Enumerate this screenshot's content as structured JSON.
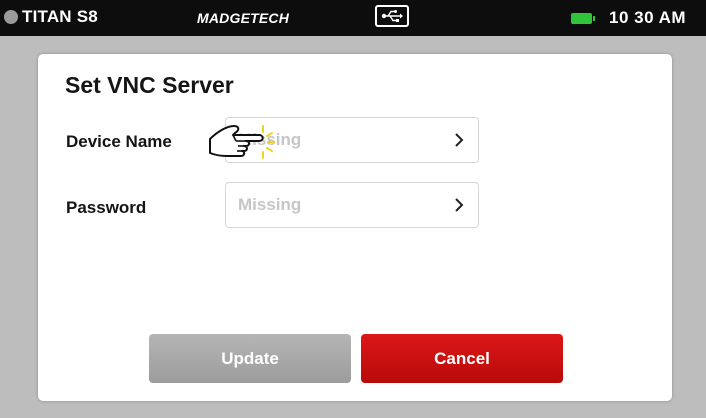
{
  "statusbar": {
    "device": "TITAN S8",
    "brand": "MADGETECH",
    "usb_icon": "usb-icon",
    "battery_icon": "battery-icon",
    "battery_color": "#2fc43a",
    "time": "10 30 AM"
  },
  "dialog": {
    "title": "Set VNC Server",
    "fields": [
      {
        "label": "Device Name",
        "value": "Missing"
      },
      {
        "label": "Password",
        "value": "Missing"
      }
    ],
    "buttons": {
      "update": "Update",
      "cancel": "Cancel"
    }
  },
  "colors": {
    "cancel": "#c81010",
    "update": "#a9a9a9",
    "placeholder": "#c6c6c6"
  },
  "overlay": {
    "pointer_icon": "hand-pointer-icon"
  }
}
